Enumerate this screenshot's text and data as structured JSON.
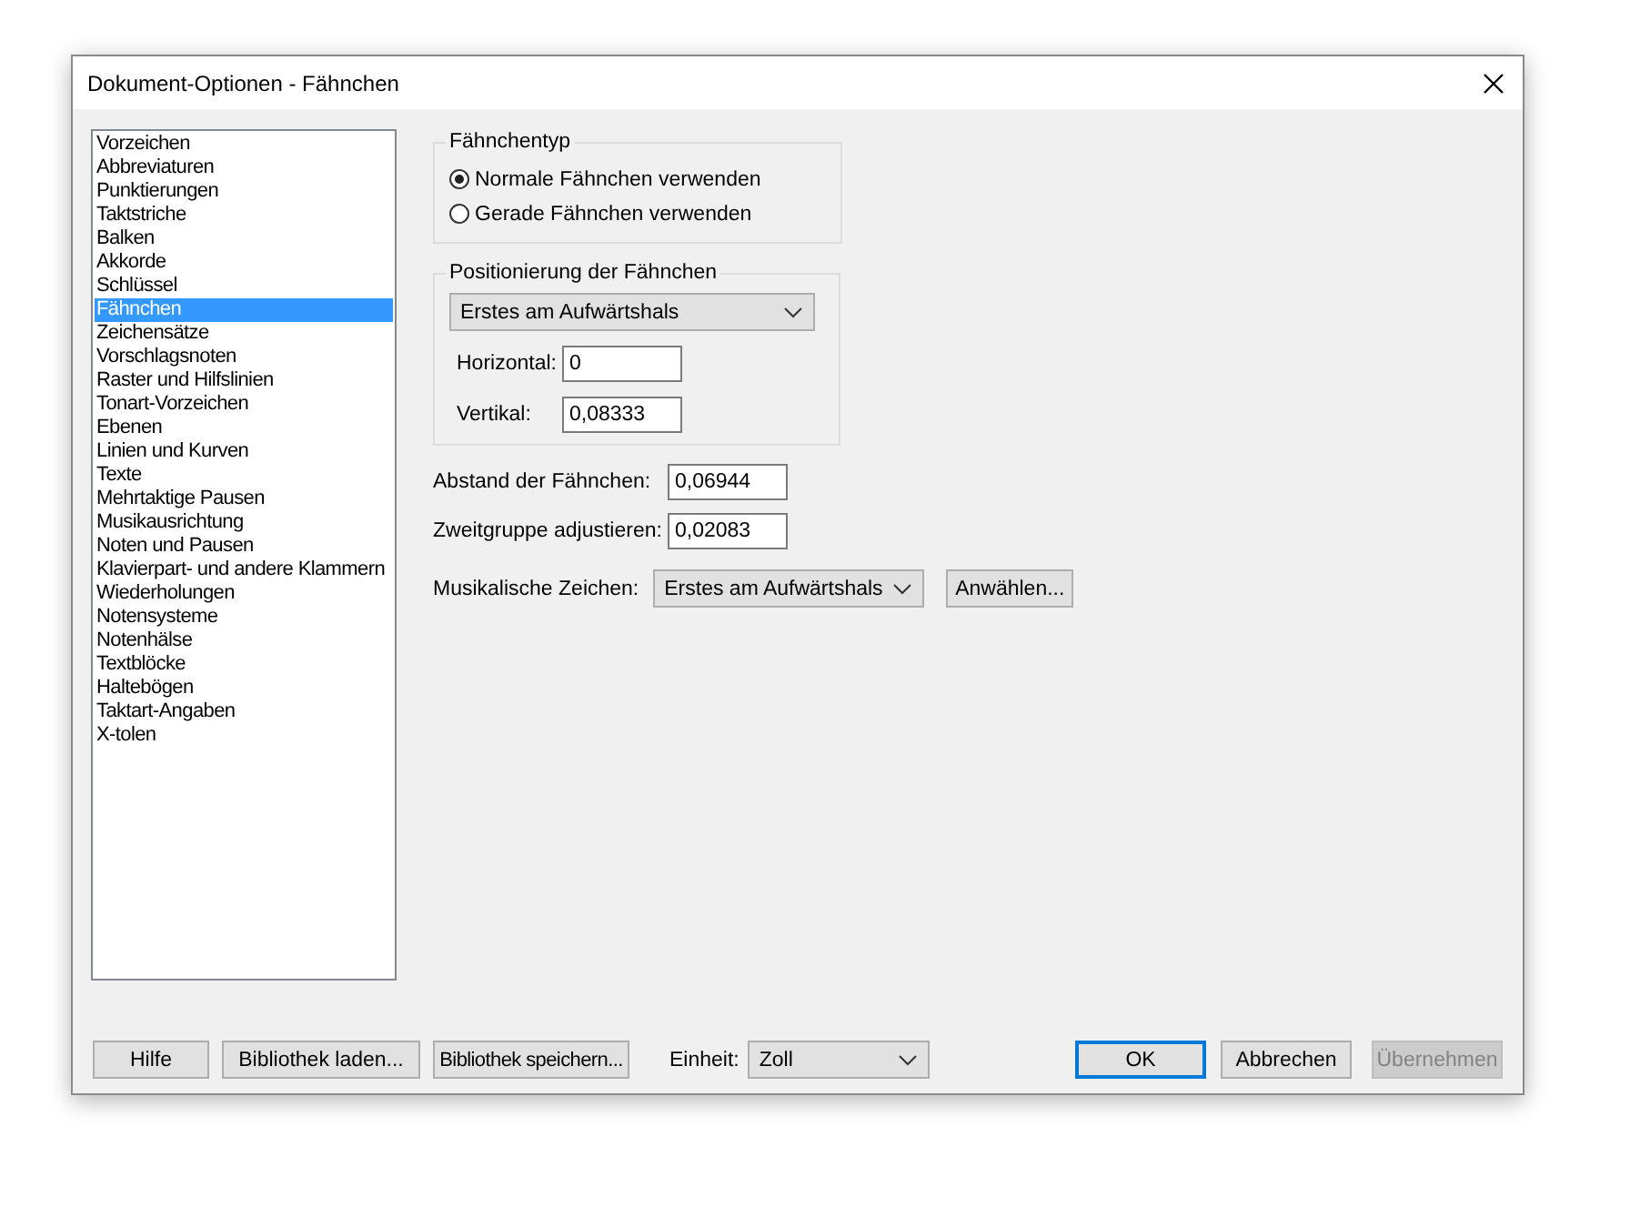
{
  "window": {
    "title": "Dokument-Optionen - Fähnchen"
  },
  "categories": [
    {
      "label": "Vorzeichen",
      "selected": false
    },
    {
      "label": "Abbreviaturen",
      "selected": false
    },
    {
      "label": "Punktierungen",
      "selected": false
    },
    {
      "label": "Taktstriche",
      "selected": false
    },
    {
      "label": "Balken",
      "selected": false
    },
    {
      "label": "Akkorde",
      "selected": false
    },
    {
      "label": "Schlüssel",
      "selected": false
    },
    {
      "label": "Fähnchen",
      "selected": true
    },
    {
      "label": "Zeichensätze",
      "selected": false
    },
    {
      "label": "Vorschlagsnoten",
      "selected": false
    },
    {
      "label": "Raster und Hilfslinien",
      "selected": false
    },
    {
      "label": "Tonart-Vorzeichen",
      "selected": false
    },
    {
      "label": "Ebenen",
      "selected": false
    },
    {
      "label": "Linien und Kurven",
      "selected": false
    },
    {
      "label": "Texte",
      "selected": false
    },
    {
      "label": "Mehrtaktige Pausen",
      "selected": false
    },
    {
      "label": "Musikausrichtung",
      "selected": false
    },
    {
      "label": "Noten und Pausen",
      "selected": false
    },
    {
      "label": "Klavierpart- und andere Klammern",
      "selected": false
    },
    {
      "label": "Wiederholungen",
      "selected": false
    },
    {
      "label": "Notensysteme",
      "selected": false
    },
    {
      "label": "Notenhälse",
      "selected": false
    },
    {
      "label": "Textblöcke",
      "selected": false
    },
    {
      "label": "Haltebögen",
      "selected": false
    },
    {
      "label": "Taktart-Angaben",
      "selected": false
    },
    {
      "label": "X-tolen",
      "selected": false
    }
  ],
  "flag_type": {
    "title": "Fähnchentyp",
    "options": [
      {
        "label": "Normale Fähnchen verwenden",
        "selected": true
      },
      {
        "label": "Gerade Fähnchen verwenden",
        "selected": false
      }
    ]
  },
  "positioning": {
    "title": "Positionierung der Fähnchen",
    "dropdown": {
      "value": "Erstes am Aufwärtshals"
    },
    "fields": [
      {
        "label": "Horizontal:",
        "value": "0"
      },
      {
        "label": "Vertikal:",
        "value": "0,08333"
      }
    ]
  },
  "fields": [
    {
      "label": "Abstand der Fähnchen:",
      "value": "0,06944"
    },
    {
      "label": "Zweitgruppe adjustieren:",
      "value": "0,02083"
    }
  ],
  "musical_symbols": {
    "label": "Musikalische Zeichen:",
    "dropdown": {
      "value": "Erstes am Aufwärtshals"
    },
    "button": "Anwählen..."
  },
  "footer": {
    "buttons": [
      "Hilfe",
      "Bibliothek laden...",
      "Bibliothek speichern..."
    ],
    "unit": {
      "label": "Einheit:",
      "value": "Zoll"
    },
    "actions": [
      {
        "label": "OK",
        "default": true,
        "disabled": false
      },
      {
        "label": "Abbrechen",
        "default": false,
        "disabled": false
      },
      {
        "label": "Übernehmen",
        "default": false,
        "disabled": true
      }
    ]
  }
}
